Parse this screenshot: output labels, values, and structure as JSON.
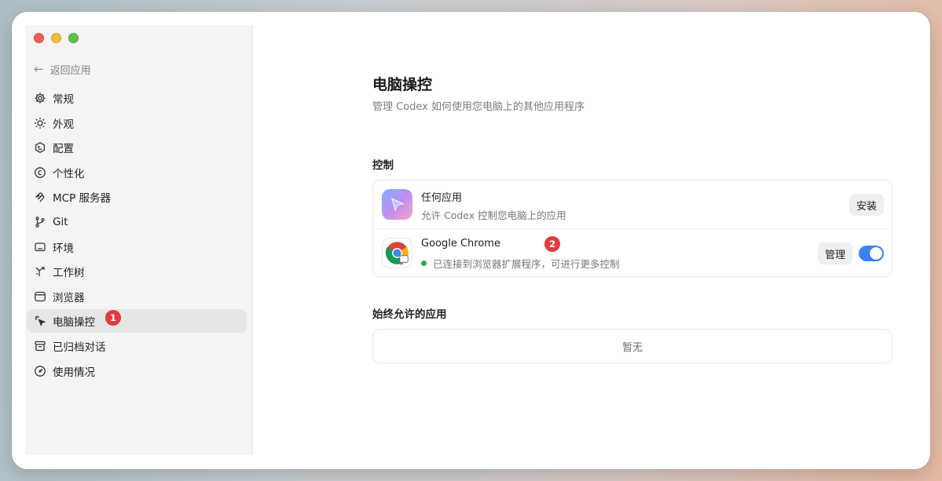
{
  "window": {
    "traffic_lights": [
      "close",
      "minimize",
      "zoom"
    ]
  },
  "sidebar": {
    "back_label": "返回应用",
    "items": [
      {
        "label": "常规",
        "icon": "gear-icon"
      },
      {
        "label": "外观",
        "icon": "sun-icon"
      },
      {
        "label": "配置",
        "icon": "face-config-icon"
      },
      {
        "label": "个性化",
        "icon": "personalize-icon"
      },
      {
        "label": "MCP 服务器",
        "icon": "mcp-icon"
      },
      {
        "label": "Git",
        "icon": "git-branch-icon"
      },
      {
        "label": "环境",
        "icon": "laptop-icon"
      },
      {
        "label": "工作树",
        "icon": "worktree-icon"
      },
      {
        "label": "浏览器",
        "icon": "browser-icon"
      },
      {
        "label": "电脑操控",
        "icon": "cursor-click-icon",
        "active": true
      },
      {
        "label": "已归档对话",
        "icon": "archive-icon"
      },
      {
        "label": "使用情况",
        "icon": "gauge-icon"
      }
    ],
    "badge": "1"
  },
  "main": {
    "title": "电脑操控",
    "subtitle": "管理 Codex 如何使用您电脑上的其他应用程序",
    "control_section_title": "控制",
    "apps": [
      {
        "name": "任何应用",
        "description": "允许 Codex 控制您电脑上的应用",
        "button_label": "安装"
      },
      {
        "name": "Google Chrome",
        "description": "已连接到浏览器扩展程序，可进行更多控制",
        "button_label": "管理",
        "status_color": "#2fa84f",
        "toggle_on": true,
        "badge": "2"
      }
    ],
    "allowed_section_title": "始终允许的应用",
    "allowed_empty": "暂无"
  },
  "colors": {
    "accent": "#3b82f6",
    "badge": "#e23c3c"
  }
}
